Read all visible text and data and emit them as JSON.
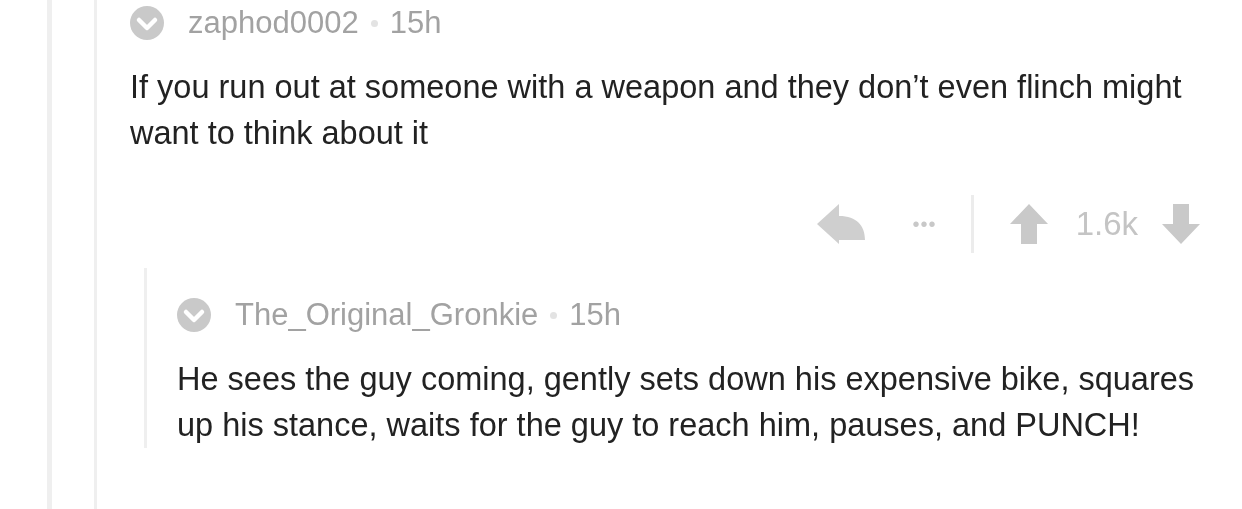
{
  "comments": [
    {
      "author": "zaphod0002",
      "age": "15h",
      "body": "If you run out at someone with a weapon and they don’t even flinch might want to think about it",
      "actions": {
        "more": "•••",
        "score": "1.6k"
      },
      "children": [
        {
          "author": "The_Original_Gronkie",
          "age": "15h",
          "body": "He sees the guy coming, gently sets down his expensive bike, squares up his stance, waits for the guy to reach him, pauses, and PUNCH!"
        }
      ]
    }
  ]
}
